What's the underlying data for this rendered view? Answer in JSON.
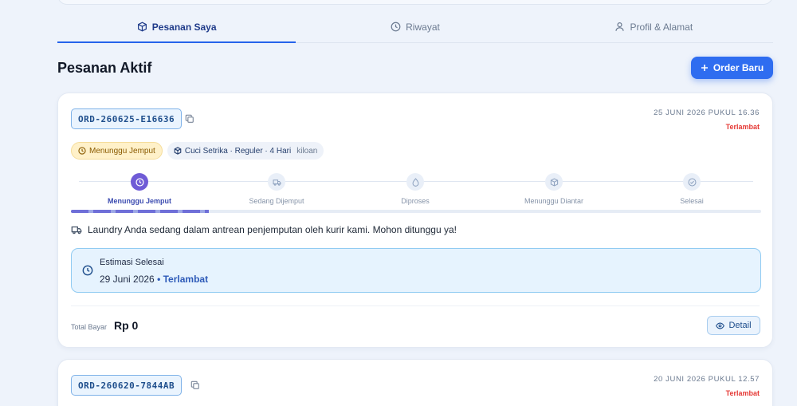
{
  "tabs": [
    {
      "label": "Pesanan Saya",
      "icon": "box-icon",
      "active": true
    },
    {
      "label": "Riwayat",
      "icon": "clock-icon",
      "active": false
    },
    {
      "label": "Profil & Alamat",
      "icon": "user-icon",
      "active": false
    }
  ],
  "section": {
    "title": "Pesanan Aktif"
  },
  "order_button": {
    "label": "Order Baru",
    "icon": "plus-icon"
  },
  "orders": [
    {
      "id": "ORD-260625-E16636",
      "date": "25 JUNI 2026 PUKUL 16.36",
      "late_label": "Terlambat",
      "status_badge": "Menunggu Jemput",
      "service": "Cuci Setrika · Reguler · 4 Hari",
      "unit": "kiloan",
      "steps": [
        "Menunggu Jemput",
        "Sedang Dijemput",
        "Diproses",
        "Menunggu Diantar",
        "Selesai"
      ],
      "active_step": 0,
      "progress": 0.2,
      "message": "Laundry Anda sedang dalam antrean penjemputan oleh kurir kami. Mohon ditunggu ya!",
      "estimate_title": "Estimasi Selesai",
      "estimate_date": "29 Juni 2026",
      "estimate_status": "• Terlambat",
      "total_label": "Total Bayar",
      "total_value": "Rp 0",
      "detail_label": "Detail"
    },
    {
      "id": "ORD-260620-7844AB",
      "date": "20 JUNI 2026 PUKUL 12.57",
      "late_label": "Terlambat"
    }
  ],
  "colors": {
    "accent": "#2f6df0",
    "late": "#e53935",
    "active_step": "#6f5bd6"
  }
}
